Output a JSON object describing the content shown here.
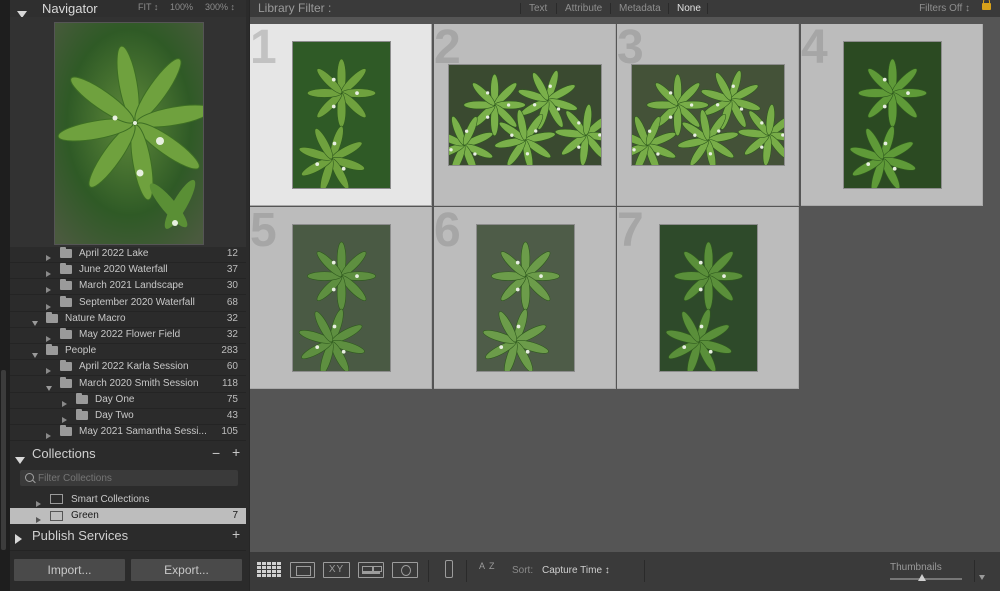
{
  "navigator": {
    "title": "Navigator",
    "zoom_options": [
      "FIT ↕",
      "100%",
      "300% ↕"
    ]
  },
  "folders": [
    {
      "label": "April 2022 Lake",
      "count": "12",
      "level": 1,
      "expanded": false
    },
    {
      "label": "June 2020 Waterfall",
      "count": "37",
      "level": 1,
      "expanded": false
    },
    {
      "label": "March 2021 Landscape",
      "count": "30",
      "level": 1,
      "expanded": false
    },
    {
      "label": "September 2020 Waterfall",
      "count": "68",
      "level": 1,
      "expanded": false
    },
    {
      "label": "Nature Macro",
      "count": "32",
      "level": 0,
      "expanded": true
    },
    {
      "label": "May 2022 Flower Field",
      "count": "32",
      "level": 1,
      "expanded": false
    },
    {
      "label": "People",
      "count": "283",
      "level": 0,
      "expanded": true
    },
    {
      "label": "April 2022 Karla Session",
      "count": "60",
      "level": 1,
      "expanded": false
    },
    {
      "label": "March 2020 Smith Session",
      "count": "118",
      "level": 1,
      "expanded": true
    },
    {
      "label": "Day One",
      "count": "75",
      "level": 2,
      "expanded": false
    },
    {
      "label": "Day Two",
      "count": "43",
      "level": 2,
      "expanded": false
    },
    {
      "label": "May 2021 Samantha Sessi...",
      "count": "105",
      "level": 1,
      "expanded": false
    }
  ],
  "collections": {
    "title": "Collections",
    "minus": "−",
    "plus": "+",
    "filter_placeholder": "Filter Collections",
    "items": [
      {
        "label": "Smart Collections",
        "count": ""
      },
      {
        "label": "Green",
        "count": "7"
      }
    ]
  },
  "publish": {
    "title": "Publish Services",
    "plus": "+"
  },
  "buttons": {
    "import": "Import...",
    "export": "Export..."
  },
  "library_filter": {
    "title": "Library Filter :",
    "tabs": [
      "Text",
      "Attribute",
      "Metadata",
      "None"
    ],
    "active_tab": "None",
    "status": "Filters Off ↕"
  },
  "grid": {
    "cells": [
      {
        "number": "1",
        "orientation": "portrait",
        "selected": true,
        "variant": "a"
      },
      {
        "number": "2",
        "orientation": "landscape",
        "selected": false,
        "variant": "b"
      },
      {
        "number": "3",
        "orientation": "landscape",
        "selected": false,
        "variant": "c"
      },
      {
        "number": "4",
        "orientation": "portrait",
        "selected": false,
        "variant": "d"
      },
      {
        "number": "5",
        "orientation": "portrait",
        "selected": false,
        "variant": "e"
      },
      {
        "number": "6",
        "orientation": "portrait",
        "selected": false,
        "variant": "f"
      },
      {
        "number": "7",
        "orientation": "portrait",
        "selected": false,
        "variant": "g"
      }
    ]
  },
  "toolbar": {
    "sort_label": "Sort:",
    "sort_value": "Capture Time ↕",
    "az_label": "A Z",
    "thumbnails_label": "Thumbnails",
    "thumbnail_size": 0.45,
    "compare_label": "XY"
  },
  "colors": {
    "accent_lock": "#d8a21a",
    "selected_cell": "#e6e6e6",
    "cell": "#bcbcbc"
  }
}
